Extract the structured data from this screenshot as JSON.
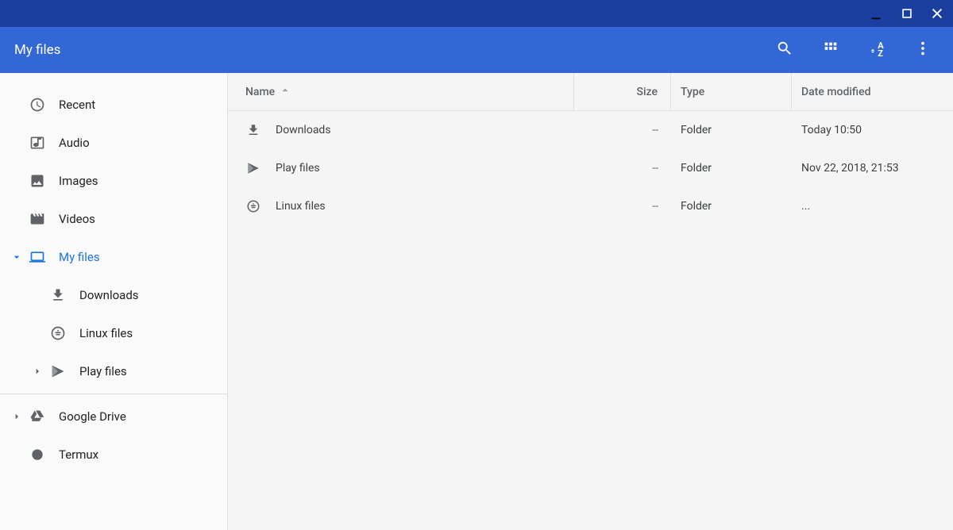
{
  "window": {
    "title": "My files"
  },
  "sidebar": {
    "items": [
      {
        "label": "Recent",
        "icon": "clock",
        "active": false,
        "expander": null,
        "depth": 0
      },
      {
        "label": "Audio",
        "icon": "audio",
        "active": false,
        "expander": null,
        "depth": 0
      },
      {
        "label": "Images",
        "icon": "image",
        "active": false,
        "expander": null,
        "depth": 0
      },
      {
        "label": "Videos",
        "icon": "video",
        "active": false,
        "expander": null,
        "depth": 0
      },
      {
        "label": "My files",
        "icon": "laptop",
        "active": true,
        "expander": "down",
        "depth": 0
      },
      {
        "label": "Downloads",
        "icon": "download",
        "active": false,
        "expander": null,
        "depth": 1
      },
      {
        "label": "Linux files",
        "icon": "linux",
        "active": false,
        "expander": null,
        "depth": 1
      },
      {
        "label": "Play files",
        "icon": "play",
        "active": false,
        "expander": "right",
        "depth": 1
      },
      {
        "divider": true
      },
      {
        "label": "Google Drive",
        "icon": "drive",
        "active": false,
        "expander": "right",
        "depth": 0
      },
      {
        "label": "Termux",
        "icon": "termux",
        "active": false,
        "expander": null,
        "depth": 0
      }
    ]
  },
  "columns": {
    "name": "Name",
    "size": "Size",
    "type": "Type",
    "date": "Date modified",
    "sort": "name-asc"
  },
  "files": [
    {
      "name": "Downloads",
      "icon": "download",
      "size": "--",
      "type": "Folder",
      "date": "Today 10:50"
    },
    {
      "name": "Play files",
      "icon": "play",
      "size": "--",
      "type": "Folder",
      "date": "Nov 22, 2018, 21:53"
    },
    {
      "name": "Linux files",
      "icon": "linux",
      "size": "--",
      "type": "Folder",
      "date": "..."
    }
  ],
  "colors": {
    "titlebar": "#1a3fa0",
    "toolbar": "#3367d6",
    "accent": "#1a73e8"
  }
}
